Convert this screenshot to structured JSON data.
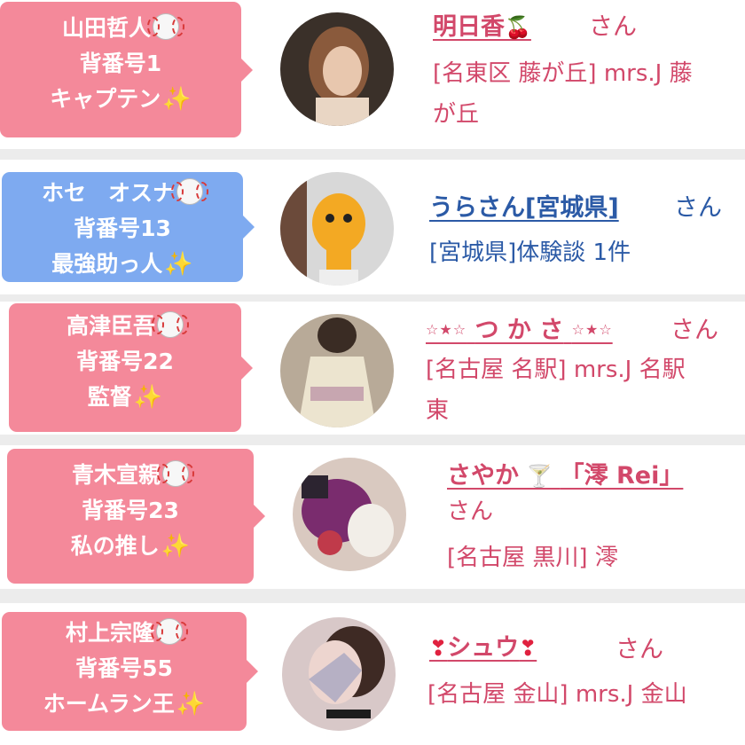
{
  "entries": [
    {
      "player_name": "山田哲人",
      "number": "背番号1",
      "role": "キャプテン",
      "bubble_color": "#f4899a",
      "therapist_name": "明日香",
      "name_suffix_icon": "cherry-icon",
      "honorific": "さん",
      "location_line1": "[名東区 藤が丘] mrs.J 藤",
      "location_line2": "が丘"
    },
    {
      "player_name": "ホセ　オスナ",
      "number": "背番号13",
      "role": "最強助っ人",
      "bubble_color": "#7eaaf0",
      "therapist_name": "うらさん[宮城県]",
      "honorific": "さん",
      "location_line1": "[宮城県]体験談 1件"
    },
    {
      "player_name": "高津臣吾",
      "number": "背番号22",
      "role": "監督",
      "bubble_color": "#f4899a",
      "name_prefix": "☆★☆",
      "therapist_name": "つ か さ",
      "name_suffix": "☆★☆",
      "honorific": "さん",
      "location_line1": "[名古屋 名駅] mrs.J 名駅",
      "location_line2": "東"
    },
    {
      "player_name": "青木宣親",
      "number": "背番号23",
      "role": "私の推し",
      "bubble_color": "#f4899a",
      "therapist_name": "さやか",
      "name_middle_icon": "cocktail-icon",
      "name_tail": "「澪 Rei」",
      "honorific": "さん",
      "location_line1": "[名古屋 黒川] 澪"
    },
    {
      "player_name": "村上宗隆",
      "number": "背番号55",
      "role": "ホームラン王",
      "bubble_color": "#f4899a",
      "name_prefix_icon": "heart-icon",
      "therapist_name": "シュウ",
      "name_suffix_icon": "heart-icon",
      "honorific": "さん",
      "location_line1": "[名古屋 金山] mrs.J 金山"
    }
  ],
  "icons": {
    "baseball": "baseball-icon",
    "sparkle": "sparkles-icon"
  },
  "colors": {
    "pink_text": "#d2486a",
    "blue_text": "#2b5aa6",
    "pink_bubble": "#f4899a",
    "blue_bubble": "#7eaaf0"
  }
}
